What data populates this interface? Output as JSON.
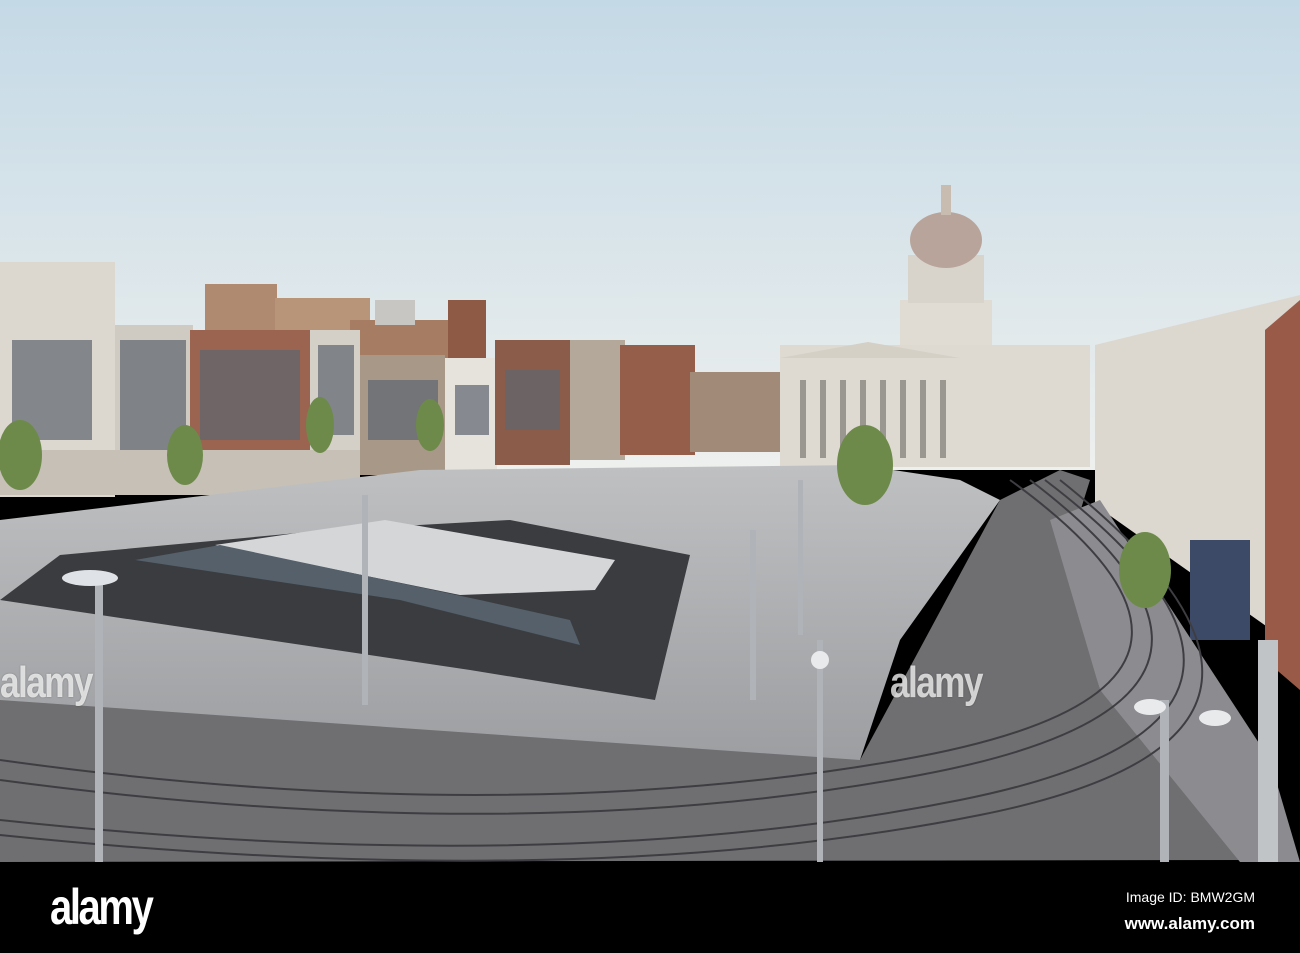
{
  "photo": {
    "colors": {
      "sky_top": "#c4d9e6",
      "sky_horizon": "#eef0ee",
      "plaza": "#a8aaac",
      "road": "#6e6d70",
      "building_stone": "#d8d4cc",
      "brick": "#8a5a48"
    }
  },
  "watermarks": {
    "brand": "alamy"
  },
  "footer": {
    "logo": "alamy",
    "image_id": "Image ID: BMW2GM",
    "website": "www.alamy.com"
  }
}
